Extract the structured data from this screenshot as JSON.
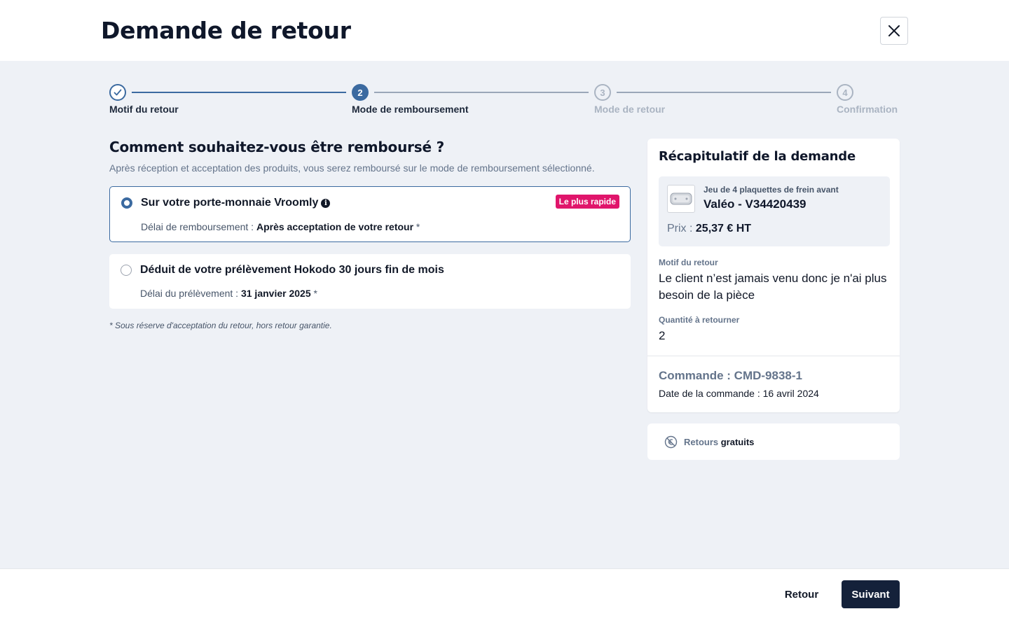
{
  "header": {
    "title": "Demande de retour",
    "close_icon": "close-icon"
  },
  "stepper": {
    "steps": [
      {
        "number": "1",
        "label": "Motif du retour",
        "state": "done"
      },
      {
        "number": "2",
        "label": "Mode de remboursement",
        "state": "active"
      },
      {
        "number": "3",
        "label": "Mode de retour",
        "state": "pending"
      },
      {
        "number": "4",
        "label": "Confirmation",
        "state": "pending"
      }
    ]
  },
  "main": {
    "title": "Comment souhaitez-vous être remboursé ?",
    "subtitle": "Après réception et acceptation des produits, vous serez remboursé sur le mode de remboursement sélectionné.",
    "options": [
      {
        "title": "Sur votre porte-monnaie Vroomly",
        "badge": "Le plus rapide",
        "detail_label": "Délai de remboursement : ",
        "detail_value": "Après acceptation de votre retour",
        "detail_suffix": " *",
        "selected": true
      },
      {
        "title": "Déduit de votre prélèvement Hokodo 30 jours fin de mois",
        "detail_label": "Délai du prélèvement : ",
        "detail_value": "31 janvier 2025",
        "detail_suffix": " *",
        "selected": false
      }
    ],
    "footnote": "* Sous réserve d'acceptation du retour, hors retour garantie."
  },
  "summary": {
    "title": "Récapitulatif de la demande",
    "product": {
      "description": "Jeu de 4 plaquettes de frein avant",
      "name": "Valéo - V34420439",
      "price_label": "Prix : ",
      "price_value": "25,37 € HT"
    },
    "reason_label": "Motif du retour",
    "reason_value": "Le client n’est jamais venu donc je n'ai plus besoin de la pièce",
    "quantity_label": "Quantité à retourner",
    "quantity_value": "2",
    "order_id": "Commande : CMD-9838-1",
    "order_date": "Date de la commande : 16 avril 2024"
  },
  "free_returns": {
    "label": "Retours ",
    "emphasis": "gratuits",
    "icon": "no-euro-icon"
  },
  "footer": {
    "back_label": "Retour",
    "next_label": "Suivant"
  },
  "colors": {
    "accent": "#3b6aa0",
    "badge": "#e0156b",
    "primary_button": "#14213a",
    "background": "#eef1f6"
  }
}
